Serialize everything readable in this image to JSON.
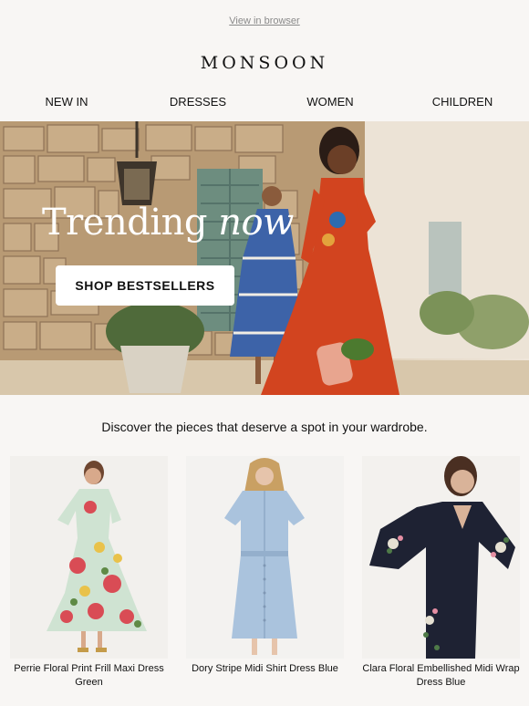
{
  "header": {
    "view_in_browser": "View in browser",
    "logo": "MONSOON"
  },
  "nav": {
    "items": [
      "NEW IN",
      "DRESSES",
      "WOMEN",
      "CHILDREN"
    ]
  },
  "hero": {
    "title_main": "Trending",
    "title_accent": "now",
    "cta": "SHOP BESTSELLERS"
  },
  "tagline": "Discover the pieces that deserve a spot in your wardrobe.",
  "products": [
    {
      "name": "Perrie Floral Print Frill Maxi Dress Green"
    },
    {
      "name": "Dory Stripe Midi Shirt Dress Blue"
    },
    {
      "name": "Clara Floral Embellished Midi Wrap Dress Blue"
    }
  ],
  "colors": {
    "background": "#f8f6f4",
    "button_bg": "#ffffff",
    "text": "#111111"
  }
}
